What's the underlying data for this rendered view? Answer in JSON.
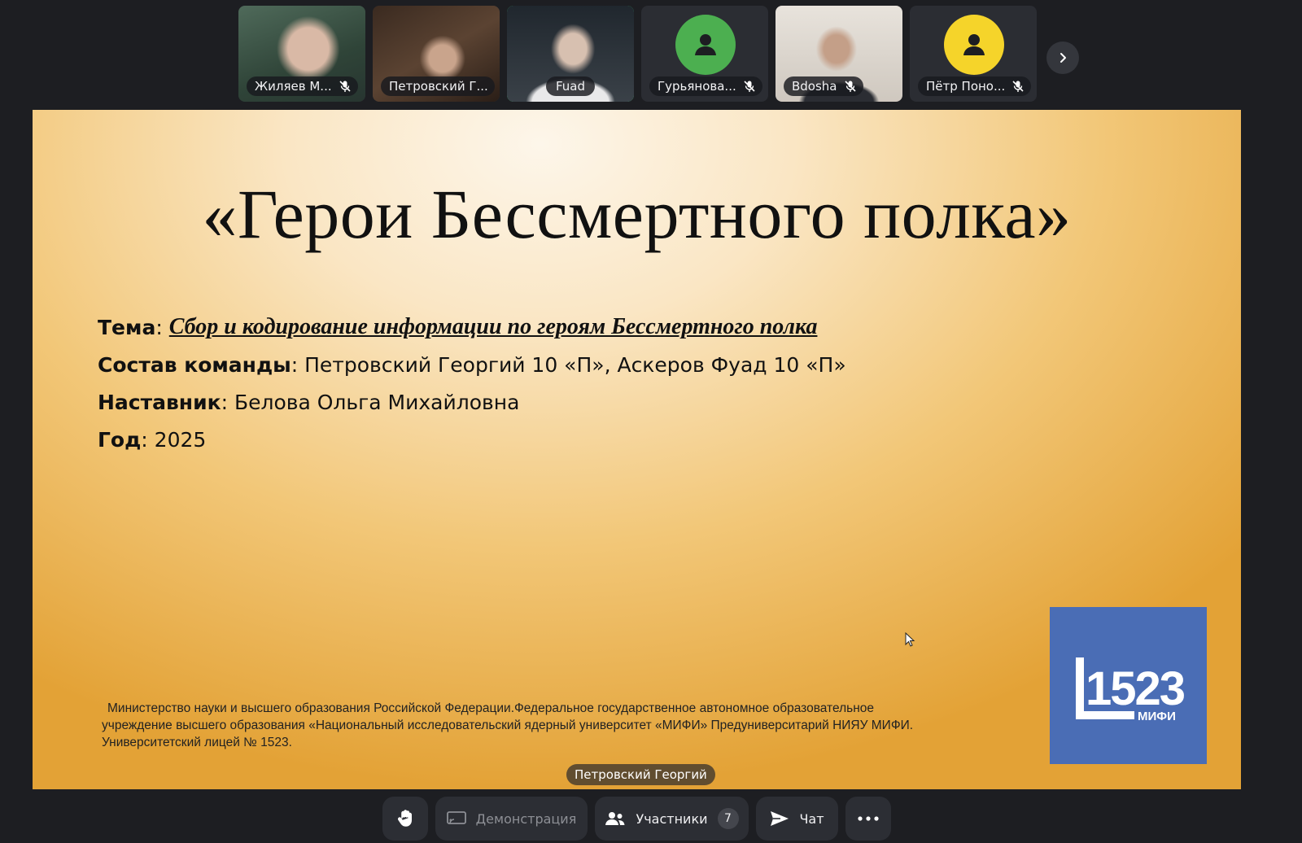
{
  "participants": [
    {
      "name": "Жиляев М...",
      "muted": true
    },
    {
      "name": "Петровский Г...",
      "muted": false
    },
    {
      "name": "Fuad",
      "muted": false,
      "speaking": true
    },
    {
      "name": "Гурьянова...",
      "muted": true,
      "avatar_color": "#4caf50"
    },
    {
      "name": "Bdosha",
      "muted": true
    },
    {
      "name": "Пётр Поно...",
      "muted": true,
      "avatar_color": "#f5d42a"
    }
  ],
  "slide": {
    "title": "«Герои Бессмертного полка»",
    "topic_label": "Тема",
    "topic_value": "Сбор и кодирование информации по героям Бессмертного полка",
    "team_label": "Состав команды",
    "team_value": "Петровский Георгий 10 «П», Аскеров Фуад 10 «П»",
    "mentor_label": "Наставник",
    "mentor_value": "Белова Ольга Михайловна",
    "year_label": "Год",
    "year_value": "2025",
    "footer_line1": "Министерство науки и высшего образования Российской Федерации.Федеральное государственное автономное образовательное",
    "footer_line2": "учреждение высшего образования «Национальный исследовательский ядерный университет «МИФИ» Предуниверситарий НИЯУ МИФИ.",
    "footer_line3": "Университетский лицей № 1523.",
    "logo_number": "1523",
    "logo_subtitle": "МИФИ",
    "logo_color": "#4a6db5"
  },
  "presenter_label": "Петровский Георгий",
  "toolbar": {
    "demo_label": "Демонстрация",
    "participants_label": "Участники",
    "participants_count": "7",
    "chat_label": "Чат"
  }
}
